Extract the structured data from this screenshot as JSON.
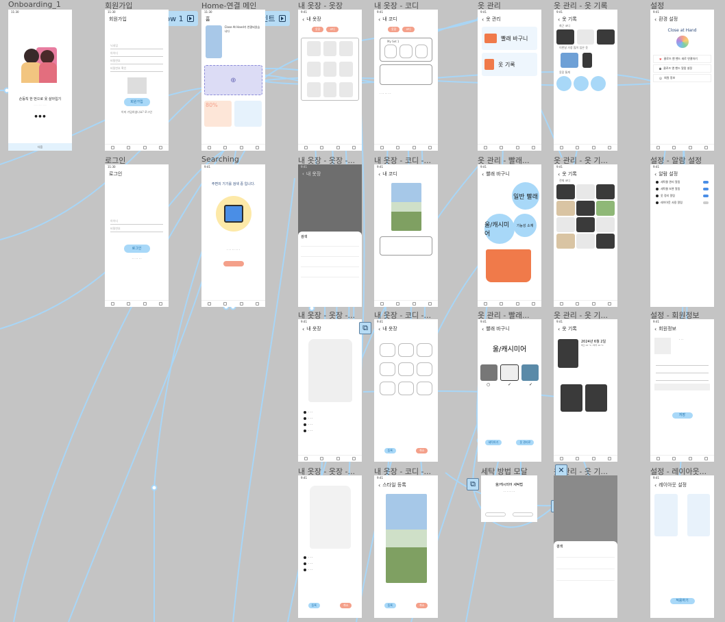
{
  "titles": {
    "onboarding": "Onboarding_1",
    "signup": "회원가입",
    "home": "Home-연결 메인",
    "closet": "내 옷장 - 옷장",
    "codi": "내 옷장 - 코디",
    "clothes_mgmt": "옷 관리",
    "clothes_log": "옷 관리 - 옷 기록",
    "settings": "설정",
    "login": "로그인",
    "searching": "Searching",
    "closet2": "내 옷장 - 옷장 -...",
    "codi2": "내 옷장 - 코디 -...",
    "laundry": "옷 관리 - 빨래...",
    "log2": "옷 관리 - 옷 기...",
    "alarm": "설정 - 알람 설정",
    "closet3": "내 옷장 - 옷장 -...",
    "codi3": "내 옷장 - 코디 -...",
    "laundry2": "옷 관리 - 빨래...",
    "log3": "옷 관리 - 옷 기...",
    "member": "설정 - 회원정보",
    "closet4": "내 옷장 - 옷장 -...",
    "codi4": "내 옷장 - 코디 -...",
    "wash_modal": "세탁 방법 모달",
    "log4": "옷 관리 - 옷 기...",
    "layout": "설정 - 레이아웃..."
  },
  "flow_tags": {
    "flow1": "Flow 1",
    "start": "시작포인트"
  },
  "onboarding": {
    "headline": "손등칙 한 번으로 옷 살아입기",
    "next": "다음"
  },
  "signup": {
    "heading": "회원가입",
    "fields": [
      "닉네임",
      "아이디",
      "비밀번호",
      "비밀번호 확인"
    ],
    "button": "회원가입",
    "footer": "이미 가입하셨나요? 로그인"
  },
  "home": {
    "heading": "홈",
    "device": "Close At Hand가 연결되었습니다",
    "percent": "80%"
  },
  "closet": {
    "heading": "내 옷장",
    "tab_a": "옷장",
    "tab_b": "코디"
  },
  "codi": {
    "heading": "내 코디",
    "set": "My Set 1"
  },
  "mgmt": {
    "heading": "옷 관리",
    "laundry": "빨래 바구니",
    "log": "옷 기록"
  },
  "log": {
    "heading": "옷 기록",
    "recent": "최근 코디",
    "long": "이번달 가장 많이 입은 옷",
    "stats": "옷장 통계"
  },
  "settings": {
    "heading": "환경 설정",
    "brand": "Close at Hand",
    "items": [
      "클로즈 앤 핸드 새로 연결하기",
      "클로즈 앤 핸드 알람 설정",
      "회원 정보"
    ]
  },
  "login": {
    "heading": "로그인",
    "fields": [
      "아이디",
      "비밀번호"
    ],
    "button": "로그인"
  },
  "searching": {
    "message": "주변의 기기를 검색 중 입니다."
  },
  "laundry": {
    "heading": "빨래 바구니",
    "normal": "일반 빨래",
    "wool": "울/캐시미어",
    "func": "기능성 소재"
  },
  "log2": {
    "heading": "옷 기록",
    "all": "전체 코디"
  },
  "alarm": {
    "heading": "알람 설정",
    "items": [
      "세탁물 관리 알림",
      "세탁물 보관 알림",
      "옷 정리 알림",
      "레이아웃 사용 알림"
    ]
  },
  "log3": {
    "date": "2024년 6월 2일",
    "weather": "최고 24 °C / 최저 19 °C"
  },
  "member": {
    "heading": "회원정보",
    "save": "저장"
  },
  "codi4": {
    "heading": "스타일 등록",
    "register": "등록",
    "cancel": "취소"
  },
  "modal": {
    "title": "울/캐시미어 세탁법"
  },
  "layout": {
    "heading": "레이아웃 설정",
    "apply": "적용하기"
  },
  "wool_screen": {
    "title": "울/캐시미어",
    "lookup": "세탁하기",
    "done": "옷 관리로"
  }
}
